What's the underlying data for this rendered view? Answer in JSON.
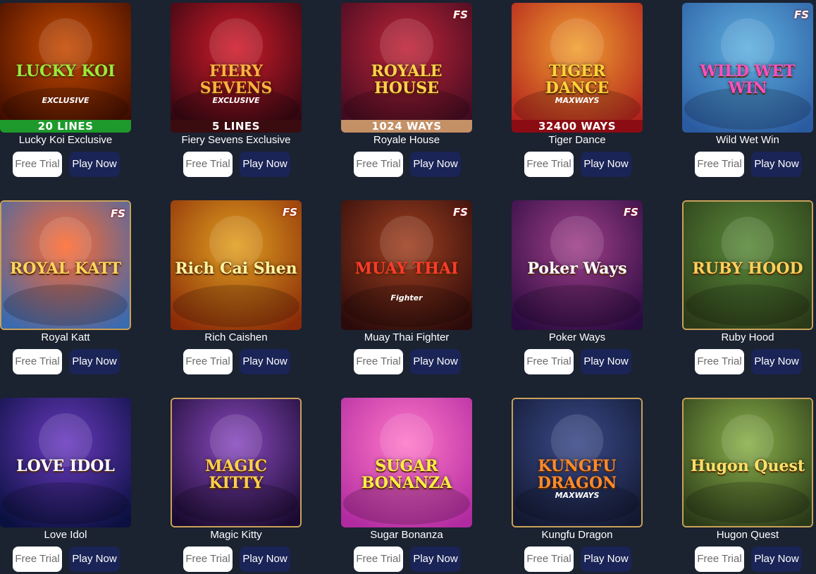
{
  "buttons": {
    "free_trial": "Free Trial",
    "play_now": "Play Now"
  },
  "games": [
    {
      "name": "Lucky Koi Exclusive",
      "art_title": "LUCKY KOI",
      "art_sub": "EXCLUSIVE",
      "banner": "20 LINES",
      "banner_color": "#1e9a2c",
      "bg1": "#c74a00",
      "bg2": "#3a0a00",
      "title_color": "#9bea3c",
      "fs": ""
    },
    {
      "name": "Fiery Sevens Exclusive",
      "art_title": "FIERY SEVENS",
      "art_sub": "EXCLUSIVE",
      "banner": "5 LINES",
      "banner_color": "#3a0c10",
      "bg1": "#d21b2a",
      "bg2": "#2a0610",
      "title_color": "#ffb341",
      "fs": ""
    },
    {
      "name": "Royale House",
      "art_title": "ROYALE HOUSE",
      "art_sub": "",
      "banner": "1024 WAYS",
      "banner_color": "#c49066",
      "bg1": "#c02438",
      "bg2": "#3a0a20",
      "title_color": "#ffd24a",
      "fs": "FS"
    },
    {
      "name": "Tiger Dance",
      "art_title": "TIGER DANCE",
      "art_sub": "MAXWAYS",
      "banner": "32400 WAYS",
      "banner_color": "#8c0c14",
      "bg1": "#f0a030",
      "bg2": "#b01c1c",
      "title_color": "#ffd23a",
      "fs": ""
    },
    {
      "name": "Wild Wet Win",
      "art_title": "WILD WET WIN",
      "art_sub": "",
      "banner": "",
      "banner_color": "",
      "bg1": "#5fb0e0",
      "bg2": "#2a5aa0",
      "title_color": "#ff4fc0",
      "fs": "FS"
    },
    {
      "name": "Royal Katt",
      "art_title": "ROYAL KATT",
      "art_sub": "",
      "banner": "",
      "banner_color": "",
      "bg1": "#ff6a30",
      "bg2": "#3a6ab0",
      "title_color": "#ffd45a",
      "fs": "FS"
    },
    {
      "name": "Rich Caishen",
      "art_title": "Rich Cai Shen",
      "art_sub": "",
      "banner": "",
      "banner_color": "",
      "bg1": "#e0a020",
      "bg2": "#8a2a08",
      "title_color": "#fff2a0",
      "fs": "FS"
    },
    {
      "name": "Muay Thai Fighter",
      "art_title": "MUAY THAI",
      "art_sub": "Fighter",
      "banner": "",
      "banner_color": "",
      "bg1": "#a04020",
      "bg2": "#2a0a0a",
      "title_color": "#ff3a2a",
      "fs": "FS"
    },
    {
      "name": "Poker Ways",
      "art_title": "Poker Ways",
      "art_sub": "",
      "banner": "",
      "banner_color": "",
      "bg1": "#a0408a",
      "bg2": "#2a0a40",
      "title_color": "#ffffff",
      "fs": "FS"
    },
    {
      "name": "Ruby Hood",
      "art_title": "RUBY HOOD",
      "art_sub": "",
      "banner": "",
      "banner_color": "",
      "bg1": "#5a8a3a",
      "bg2": "#2a3a18",
      "title_color": "#ffcf5a",
      "fs": ""
    },
    {
      "name": "Love Idol",
      "art_title": "LOVE IDOL",
      "art_sub": "",
      "banner": "",
      "banner_color": "",
      "bg1": "#6a3ac0",
      "bg2": "#0a1040",
      "title_color": "#ffffff",
      "fs": ""
    },
    {
      "name": "Magic Kitty",
      "art_title": "MAGIC KITTY",
      "art_sub": "",
      "banner": "",
      "banner_color": "",
      "bg1": "#8a4ac0",
      "bg2": "#1a0a30",
      "title_color": "#ffd04a",
      "fs": ""
    },
    {
      "name": "Sugar Bonanza",
      "art_title": "SUGAR BONANZA",
      "art_sub": "",
      "banner": "",
      "banner_color": "",
      "bg1": "#ff78c8",
      "bg2": "#b02aa0",
      "title_color": "#ffef40",
      "fs": ""
    },
    {
      "name": "Kungfu Dragon",
      "art_title": "KUNGFU DRAGON",
      "art_sub": "MAXWAYS",
      "banner": "",
      "banner_color": "",
      "bg1": "#3a4a8a",
      "bg2": "#121830",
      "title_color": "#ff8a2a",
      "fs": ""
    },
    {
      "name": "Hugon Quest",
      "art_title": "Hugon Quest",
      "art_sub": "",
      "banner": "",
      "banner_color": "",
      "bg1": "#8ab04a",
      "bg2": "#2a3a18",
      "title_color": "#ffe06a",
      "fs": ""
    }
  ]
}
